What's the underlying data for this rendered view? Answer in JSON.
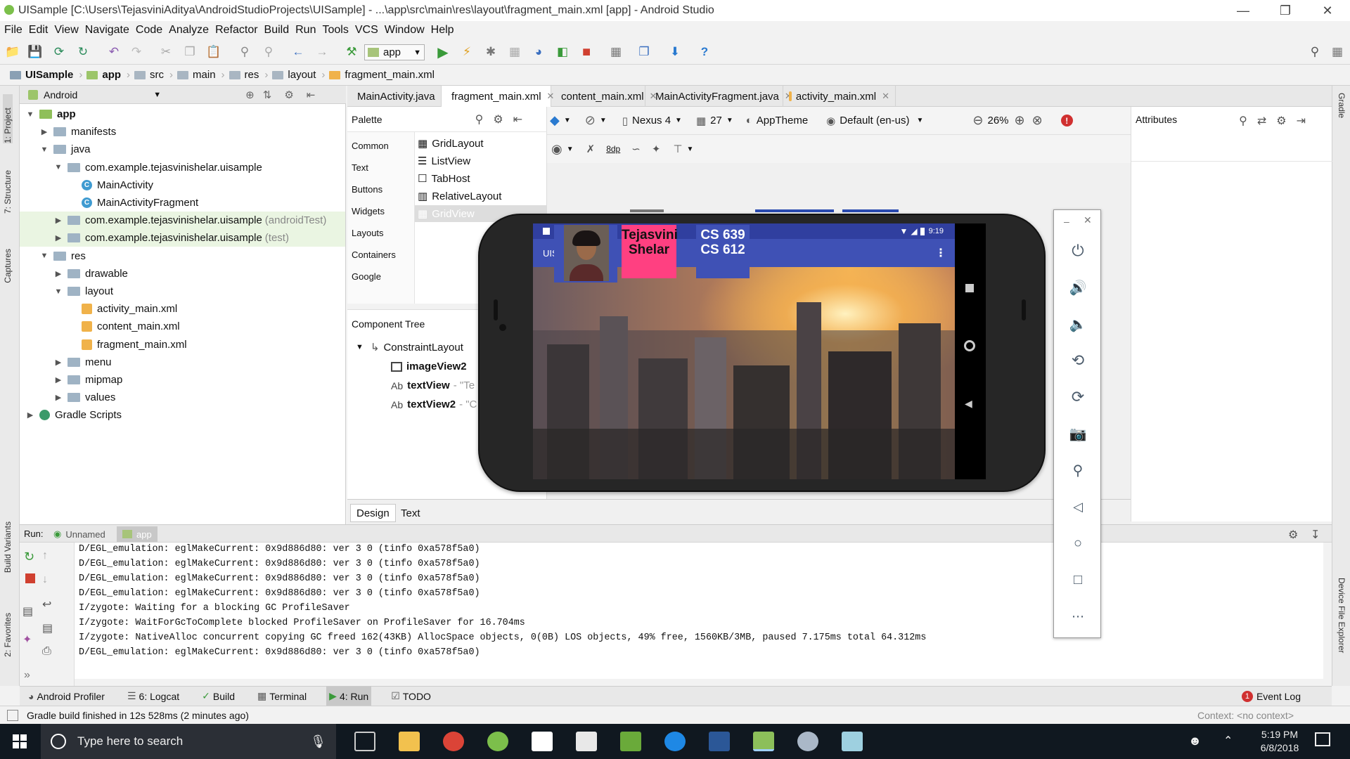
{
  "window": {
    "title": "UISample [C:\\Users\\TejasviniAditya\\AndroidStudioProjects\\UISample] - ...\\app\\src\\main\\res\\layout\\fragment_main.xml [app] - Android Studio"
  },
  "menu": [
    "File",
    "Edit",
    "View",
    "Navigate",
    "Code",
    "Analyze",
    "Refactor",
    "Build",
    "Run",
    "Tools",
    "VCS",
    "Window",
    "Help"
  ],
  "toolbar": {
    "config": "app"
  },
  "breadcrumb": [
    "UISample",
    "app",
    "src",
    "main",
    "res",
    "layout",
    "fragment_main.xml"
  ],
  "left_strip": {
    "project": "1: Project",
    "structure": "7: Structure",
    "captures": "Captures",
    "build_variants": "Build Variants",
    "favorites": "2: Favorites"
  },
  "right_strip": {
    "gradle": "Gradle",
    "device_explorer": "Device File Explorer"
  },
  "project_panel": {
    "view": "Android",
    "tree": [
      {
        "label": "app",
        "level": 0,
        "kind": "module",
        "expanded": true
      },
      {
        "label": "manifests",
        "level": 1,
        "kind": "folder"
      },
      {
        "label": "java",
        "level": 1,
        "kind": "folder",
        "expanded": true
      },
      {
        "label": "com.example.tejasvinishelar.uisample",
        "level": 2,
        "kind": "folder",
        "expanded": true
      },
      {
        "label": "MainActivity",
        "level": 3,
        "kind": "class"
      },
      {
        "label": "MainActivityFragment",
        "level": 3,
        "kind": "class"
      },
      {
        "label": "com.example.tejasvinishelar.uisample",
        "suffix": "(androidTest)",
        "level": 2,
        "kind": "folder",
        "highlight": true
      },
      {
        "label": "com.example.tejasvinishelar.uisample",
        "suffix": "(test)",
        "level": 2,
        "kind": "folder",
        "highlight": true
      },
      {
        "label": "res",
        "level": 1,
        "kind": "folder",
        "expanded": true
      },
      {
        "label": "drawable",
        "level": 2,
        "kind": "folder"
      },
      {
        "label": "layout",
        "level": 2,
        "kind": "folder",
        "expanded": true
      },
      {
        "label": "activity_main.xml",
        "level": 3,
        "kind": "xml"
      },
      {
        "label": "content_main.xml",
        "level": 3,
        "kind": "xml"
      },
      {
        "label": "fragment_main.xml",
        "level": 3,
        "kind": "xml"
      },
      {
        "label": "menu",
        "level": 2,
        "kind": "folder"
      },
      {
        "label": "mipmap",
        "level": 2,
        "kind": "folder"
      },
      {
        "label": "values",
        "level": 2,
        "kind": "folder"
      },
      {
        "label": "Gradle Scripts",
        "level": 0,
        "kind": "gradle"
      }
    ]
  },
  "editor_tabs": [
    {
      "label": "MainActivity.java",
      "active": false
    },
    {
      "label": "fragment_main.xml",
      "active": true
    },
    {
      "label": "content_main.xml",
      "active": false
    },
    {
      "label": "MainActivityFragment.java",
      "active": false
    },
    {
      "label": "activity_main.xml",
      "active": false
    }
  ],
  "palette": {
    "title": "Palette",
    "categories": [
      "Common",
      "Text",
      "Buttons",
      "Widgets",
      "Layouts",
      "Containers",
      "Google"
    ],
    "items": [
      "GridLayout",
      "ListView",
      "TabHost",
      "RelativeLayout",
      "GridView"
    ]
  },
  "design_toolbar": {
    "device": "Nexus 4",
    "api": "27",
    "theme": "AppTheme",
    "locale": "Default (en-us)",
    "zoom": "26%",
    "margin": "8dp"
  },
  "attributes": {
    "title": "Attributes"
  },
  "component_tree": {
    "title": "Component Tree",
    "root": "ConstraintLayout",
    "children": [
      {
        "name": "imageView2",
        "prefix": ""
      },
      {
        "name": "textView",
        "prefix": "Ab",
        "hint": "- \"Te"
      },
      {
        "name": "textView2",
        "prefix": "Ab",
        "hint": "- \"C"
      }
    ]
  },
  "design_tabs": [
    "Design",
    "Text"
  ],
  "run_panel": {
    "label": "Run:",
    "tabs": [
      "Unnamed",
      "app"
    ],
    "log": [
      "D/EGL_emulation: eglMakeCurrent: 0x9d886d80: ver 3 0 (tinfo 0xa578f5a0)",
      "D/EGL_emulation: eglMakeCurrent: 0x9d886d80: ver 3 0 (tinfo 0xa578f5a0)",
      "D/EGL_emulation: eglMakeCurrent: 0x9d886d80: ver 3 0 (tinfo 0xa578f5a0)",
      "D/EGL_emulation: eglMakeCurrent: 0x9d886d80: ver 3 0 (tinfo 0xa578f5a0)",
      "I/zygote: Waiting for a blocking GC ProfileSaver",
      "I/zygote: WaitForGcToComplete blocked ProfileSaver on ProfileSaver for 16.704ms",
      "I/zygote: NativeAlloc concurrent copying GC freed 162(43KB) AllocSpace objects, 0(0B) LOS objects, 49% free, 1560KB/3MB, paused 7.175ms total 64.312ms",
      "D/EGL_emulation: eglMakeCurrent: 0x9d886d80: ver 3 0 (tinfo 0xa578f5a0)"
    ]
  },
  "bottom_tabs": [
    "Android Profiler",
    "6: Logcat",
    "Build",
    "Terminal",
    "4: Run",
    "TODO"
  ],
  "event_log": {
    "label": "Event Log",
    "count": "1"
  },
  "status": {
    "message": "Gradle build finished in 12s 528ms (2 minutes ago)",
    "context": "Context: <no context>"
  },
  "emulator": {
    "time": "9:19",
    "app_title": "UISample",
    "name_text": "Tejasvini\nShelar",
    "courses_text": "CS 639\nCS 612"
  },
  "taskbar": {
    "search_placeholder": "Type here to search",
    "time": "5:19 PM",
    "date": "6/8/2018"
  },
  "colors": {
    "accent": "#3F51B5",
    "name_bg": "#FF4081",
    "course_bg": "#3F51B5",
    "run_icon": "#3a9a3a",
    "tree_highlight": "#eaf5e2"
  }
}
